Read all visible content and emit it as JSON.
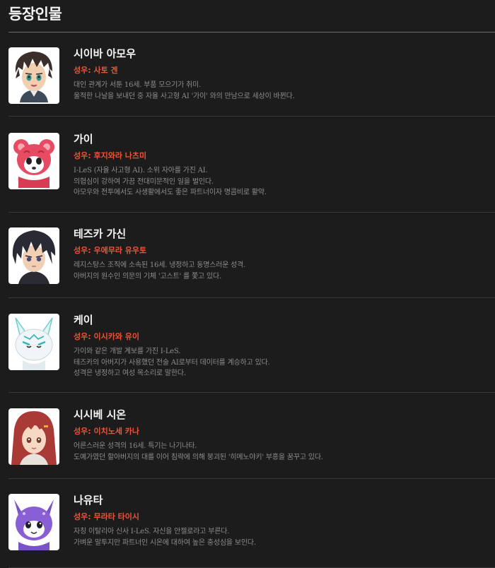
{
  "page_title": "등장인물",
  "characters": [
    {
      "name": "시이바 아모우",
      "cv": "성우: 사토 겐",
      "desc": [
        "대인 관계가 서툰 16세. 부품 모으기가 취미.",
        "울적한 나날을 보내던 중 자율 사고형 AI '가이' 와의 만남으로 세상이 바뀐다."
      ]
    },
    {
      "name": "가이",
      "cv": "성우: 후지와라 나츠미",
      "desc": [
        "I-LeS (자율 사고형 AI). 소위 자아를 가진 AI.",
        "의협심이 강하여 가끔 전대미문적인 일을 벌인다.",
        "아모우와 전투에서도 사생활에서도 좋은 파트너이자 명콤비로 활약."
      ]
    },
    {
      "name": "테즈카 가신",
      "cv": "성우: 우에무라 유우토",
      "desc": [
        "레지스탕스 조직에 소속된 16세. 냉정하고 동명스러운 성격.",
        "아버지의 원수인 의문의 기체 '고스트' 를 쫓고 있다."
      ]
    },
    {
      "name": "케이",
      "cv": "성우: 이시카와 유이",
      "desc": [
        "가이와 같은 개발 계보를 가진 I-LeS.",
        "테즈카의 아버지가 사용했던 전술 AI로부터 데이터를 계승하고 있다.",
        "성격은 냉정하고 여성 목소리로 말한다."
      ]
    },
    {
      "name": "시시베 시온",
      "cv": "성우: 이치노세 카나",
      "desc": [
        "어른스러운 성격의 16세. 특기는 나기나타.",
        "도예가였던 할아버지의 대를 이어 침략에 의해 붕괴된 '히메노야키' 부흥을 꿈꾸고 있다."
      ]
    },
    {
      "name": "나유타",
      "cv": "성우: 무라타 타이시",
      "desc": [
        "자칭 이탈리아 신사 I-LeS. 자신을 안젤로라고 부른다.",
        "가벼운 말투지만 파트너인 시온에 대하여 높은 충성심을 보인다."
      ]
    }
  ]
}
